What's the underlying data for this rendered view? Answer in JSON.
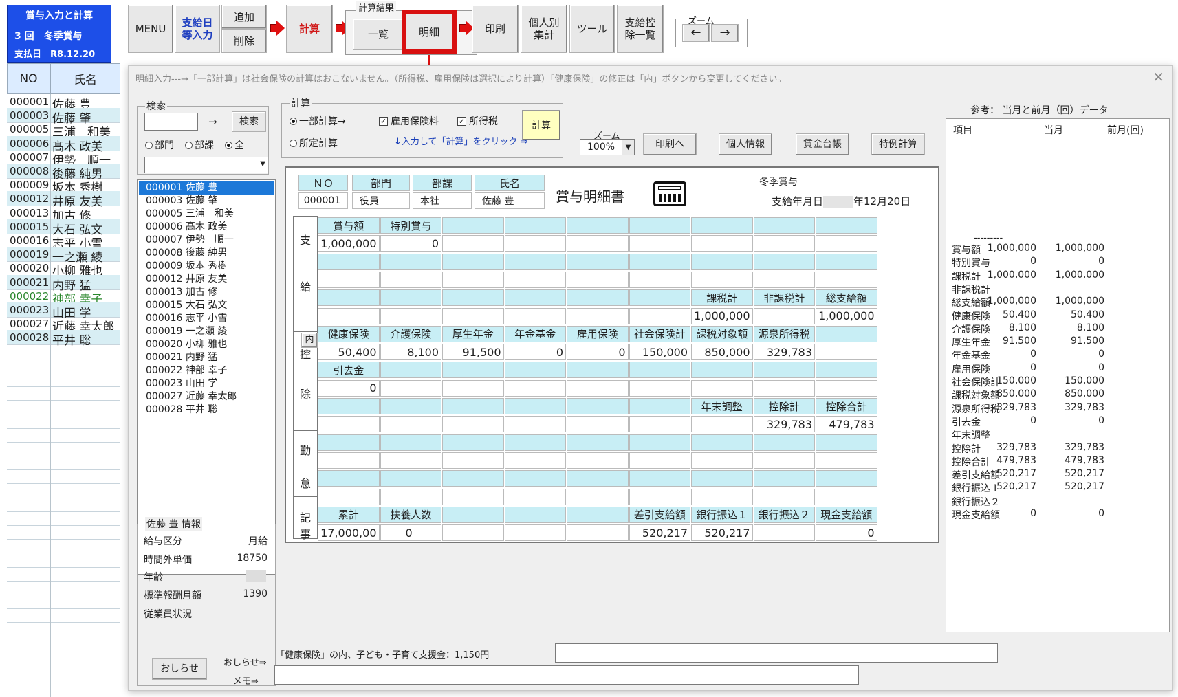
{
  "header": {
    "title": "賞与入力と計算",
    "round_line": "3 回　冬季賞与",
    "paydate_label": "支払日",
    "paydate": "R8.12.20"
  },
  "toolbar": {
    "menu": "MENU",
    "paydate_input_1": "支給日",
    "paydate_input_2": "等入力",
    "add": "追加",
    "delete": "削除",
    "calc": "計算",
    "result_group": "計算結果",
    "list": "一覧",
    "detail": "明細",
    "print": "印刷",
    "personal_1": "個人別",
    "personal_2": "集計",
    "tools": "ツール",
    "deduct_1": "支給控",
    "deduct_2": "除一覧",
    "zoom_group": "ズーム",
    "zoom_left": "←",
    "zoom_right": "→"
  },
  "grid": {
    "col_no": "NO",
    "col_name": "氏名",
    "rows": [
      {
        "no": "000001",
        "name": "佐藤 豊"
      },
      {
        "no": "000003",
        "name": "佐藤 肇"
      },
      {
        "no": "000005",
        "name": "三浦　和美"
      },
      {
        "no": "000006",
        "name": "髙木 政美"
      },
      {
        "no": "000007",
        "name": "伊勢　順一"
      },
      {
        "no": "000008",
        "name": "後藤 純男"
      },
      {
        "no": "000009",
        "name": "坂本 秀樹"
      },
      {
        "no": "000012",
        "name": "井原 友美"
      },
      {
        "no": "000013",
        "name": "加古 修"
      },
      {
        "no": "000015",
        "name": "大石 弘文"
      },
      {
        "no": "000016",
        "name": "志平 小雪"
      },
      {
        "no": "000019",
        "name": "一之瀬 綾"
      },
      {
        "no": "000020",
        "name": "小柳 雅也"
      },
      {
        "no": "000021",
        "name": "内野 猛"
      },
      {
        "no": "000022",
        "name": "神部 幸子"
      },
      {
        "no": "000023",
        "name": "山田 学"
      },
      {
        "no": "000027",
        "name": "近藤 幸太郎"
      },
      {
        "no": "000028",
        "name": "平井 聡"
      }
    ]
  },
  "dialog": {
    "message": "明細入力---→「一部計算」は社会保険の計算はおこないません。（所得税、雇用保険は選択により計算）「健康保険」の修正は「内」ボタンから変更してください。",
    "close": "✕",
    "search": {
      "group": "検索",
      "arrow": "→",
      "button": "検索",
      "radio_dept": "部門",
      "radio_section": "部課",
      "radio_all": "全",
      "dropdown_arrow": "▼"
    },
    "employee_list": [
      "000001 佐藤 豊",
      "000003 佐藤 肇",
      "000005 三浦　和美",
      "000006 髙木 政美",
      "000007 伊勢　順一",
      "000008 後藤 純男",
      "000009 坂本 秀樹",
      "000012 井原 友美",
      "000013 加古 修",
      "000015 大石 弘文",
      "000016 志平 小雪",
      "000019 一之瀬 綾",
      "000020 小柳 雅也",
      "000021 内野 猛",
      "000022 神部 幸子",
      "000023 山田 学",
      "000027 近藤 幸太郎",
      "000028 平井 聡"
    ],
    "info": {
      "group": "佐藤 豊 情報",
      "pay_type_label": "給与区分",
      "pay_type": "月給",
      "overtime_label": "時間外単価",
      "overtime": "18750",
      "age_label": "年齢",
      "std_label": "標準報酬月額",
      "std": "1390",
      "status_label": "従業員状況",
      "notice_button": "おしらせ",
      "notice_link": "おしらせ⇒",
      "memo_link": "メモ⇒"
    },
    "calc": {
      "group": "計算",
      "partial": "一部計算→",
      "employment": "雇用保険料",
      "income_tax": "所得税",
      "fixed": "所定計算",
      "hint": "↓入力して「計算」をクリック ⇒",
      "button": "計算",
      "zoom_label": "ズーム",
      "zoom_value": "100%",
      "print": "印刷へ",
      "personal": "個人情報",
      "ledger": "賃金台帳",
      "special": "特例計算"
    },
    "footer_note": "「健康保険」の内、子ども・子育て支援金：1,150円"
  },
  "stub": {
    "head_no": "ＮＯ",
    "head_dept": "部門",
    "head_section": "部課",
    "head_name": "氏名",
    "no": "000001",
    "dept": "役員",
    "section": "本社",
    "name": "佐藤 豊",
    "doc_title": "賞与明細書",
    "kind": "冬季賞与",
    "date_label": "支給年月日",
    "date_value": "年12月20日",
    "side_pay_1": "支",
    "side_pay_2": "給",
    "side_ded_1": "控",
    "side_ded_2": "除",
    "side_att_1": "勤",
    "side_att_2": "怠",
    "side_rec_1": "記",
    "side_rec_2": "事",
    "inner_btn": "内",
    "pay": {
      "bonus_label": "賞与額",
      "bonus": "1,000,000",
      "special_label": "特別賞与",
      "special": "0",
      "taxable_label": "課税計",
      "taxable": "1,000,000",
      "nontax_label": "非課税計",
      "total_label": "総支給額",
      "total": "1,000,000"
    },
    "ded": {
      "health_label": "健康保険",
      "health": "50,400",
      "care_label": "介護保険",
      "care": "8,100",
      "pension_label": "厚生年金",
      "pension": "91,500",
      "fund_label": "年金基金",
      "fund": "0",
      "emp_label": "雇用保険",
      "emp": "0",
      "social_label": "社会保険計",
      "social": "150,000",
      "taxbase_label": "課税対象額",
      "taxbase": "850,000",
      "withhold_label": "源泉所得税",
      "withhold": "329,783",
      "hikisaki_label": "引去金",
      "hikisaki": "0",
      "yearend_label": "年末調整",
      "dedsum_label": "控除計",
      "dedsum": "329,783",
      "dedtotal_label": "控除合計",
      "dedtotal": "479,783"
    },
    "rec": {
      "cum_label": "累計",
      "cum": "17,000,00",
      "dep_label": "扶養人数",
      "dep": "0",
      "net_label": "差引支給額",
      "net": "520,217",
      "bank1_label": "銀行振込１",
      "bank1": "520,217",
      "bank2_label": "銀行振込２",
      "cash_label": "現金支給額",
      "cash": "0"
    }
  },
  "reference": {
    "title": "参考： 当月と前月（回）データ",
    "col_item": "項目",
    "col_cur": "当月",
    "col_prev": "前月(回)",
    "separator": "---------",
    "rows": [
      {
        "k": "賞与額",
        "a": "1,000,000",
        "b": "1,000,000"
      },
      {
        "k": "特別賞与",
        "a": "0",
        "b": "0"
      },
      {
        "k": "課税計",
        "a": "1,000,000",
        "b": "1,000,000"
      },
      {
        "k": "非課税計",
        "a": "",
        "b": ""
      },
      {
        "k": "総支給額",
        "a": "1,000,000",
        "b": "1,000,000"
      },
      {
        "k": "健康保険",
        "a": "50,400",
        "b": "50,400"
      },
      {
        "k": "介護保険",
        "a": "8,100",
        "b": "8,100"
      },
      {
        "k": "厚生年金",
        "a": "91,500",
        "b": "91,500"
      },
      {
        "k": "年金基金",
        "a": "0",
        "b": "0"
      },
      {
        "k": "雇用保険",
        "a": "0",
        "b": "0"
      },
      {
        "k": "社会保険計",
        "a": "150,000",
        "b": "150,000"
      },
      {
        "k": "課税対象額",
        "a": "850,000",
        "b": "850,000"
      },
      {
        "k": "源泉所得税",
        "a": "329,783",
        "b": "329,783"
      },
      {
        "k": "引去金",
        "a": "0",
        "b": "0"
      },
      {
        "k": "年末調整",
        "a": "",
        "b": ""
      },
      {
        "k": "控除計",
        "a": "329,783",
        "b": "329,783"
      },
      {
        "k": "控除合計",
        "a": "479,783",
        "b": "479,783"
      },
      {
        "k": "差引支給額",
        "a": "520,217",
        "b": "520,217"
      },
      {
        "k": "銀行振込１",
        "a": "520,217",
        "b": "520,217"
      },
      {
        "k": "銀行振込２",
        "a": "",
        "b": ""
      },
      {
        "k": "現金支給額",
        "a": "0",
        "b": "0"
      }
    ]
  },
  "colors": {
    "title_bg": "#1d4fe8",
    "header_cell": "#c8eef5",
    "accent_red": "#e01010",
    "selection": "#1c78d8"
  }
}
